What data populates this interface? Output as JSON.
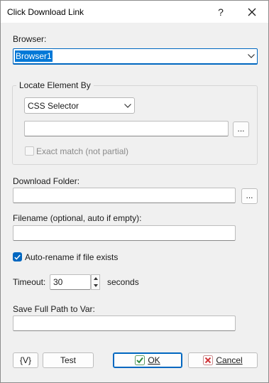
{
  "window": {
    "title": "Click Download Link",
    "help_label": "?",
    "close_icon": "close-icon"
  },
  "browser": {
    "label": "Browser:",
    "selected": "Browser1"
  },
  "locate": {
    "group_label": "Locate Element By",
    "method_selected": "CSS Selector",
    "selector_value": "",
    "browse_label": "...",
    "exact_match_label": "Exact match (not partial)",
    "exact_match_checked": false
  },
  "download_folder": {
    "label": "Download Folder:",
    "value": "",
    "browse_label": "..."
  },
  "filename": {
    "label": "Filename (optional, auto if empty):",
    "value": ""
  },
  "auto_rename": {
    "label": "Auto-rename if file exists",
    "checked": true
  },
  "timeout": {
    "label": "Timeout:",
    "value": "30",
    "unit": "seconds"
  },
  "save_path": {
    "label": "Save Full Path to Var:",
    "value": ""
  },
  "footer": {
    "var_button": "{V}",
    "test_button": "Test",
    "ok_button": "OK",
    "cancel_button": "Cancel"
  },
  "colors": {
    "accent": "#0067c0",
    "ok_icon": "#2e8b3e",
    "cancel_icon": "#d13438"
  }
}
